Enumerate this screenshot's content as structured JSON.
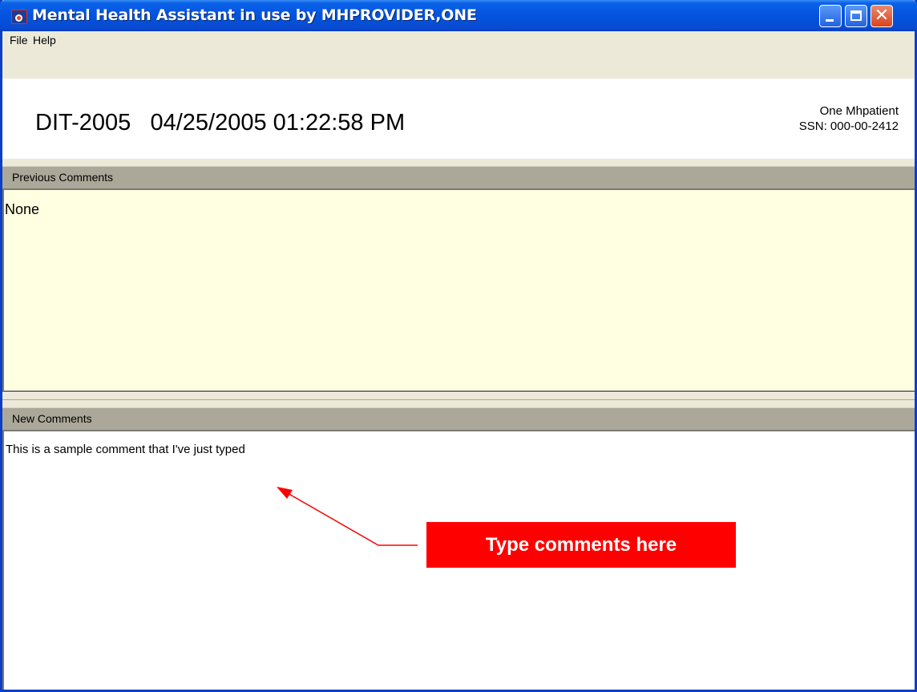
{
  "window": {
    "title": "Mental Health Assistant in use by MHPROVIDER,ONE",
    "app_icon": "app-logo-icon",
    "controls": [
      "minimize-icon",
      "maximize-icon",
      "close-icon"
    ],
    "close_glyph": "✕"
  },
  "menu": {
    "file": "File",
    "help": "Help"
  },
  "header": {
    "instrument_and_datetime": "DIT-2005   04/25/2005 01:22:58 PM",
    "patient_name": "One Mhpatient",
    "patient_ssn": "SSN: 000-00-2412"
  },
  "previous_comments": {
    "label": "Previous Comments",
    "text": "None"
  },
  "new_comments": {
    "label": "New Comments",
    "text": "This is a sample comment that I've just typed"
  },
  "callout": {
    "text": "Type comments here",
    "color": "#ff0000"
  },
  "colors": {
    "title_bar": "#0454e0",
    "section_header": "#aca899",
    "previous_background": "#ffffe1",
    "window_face": "#ece9d8"
  }
}
